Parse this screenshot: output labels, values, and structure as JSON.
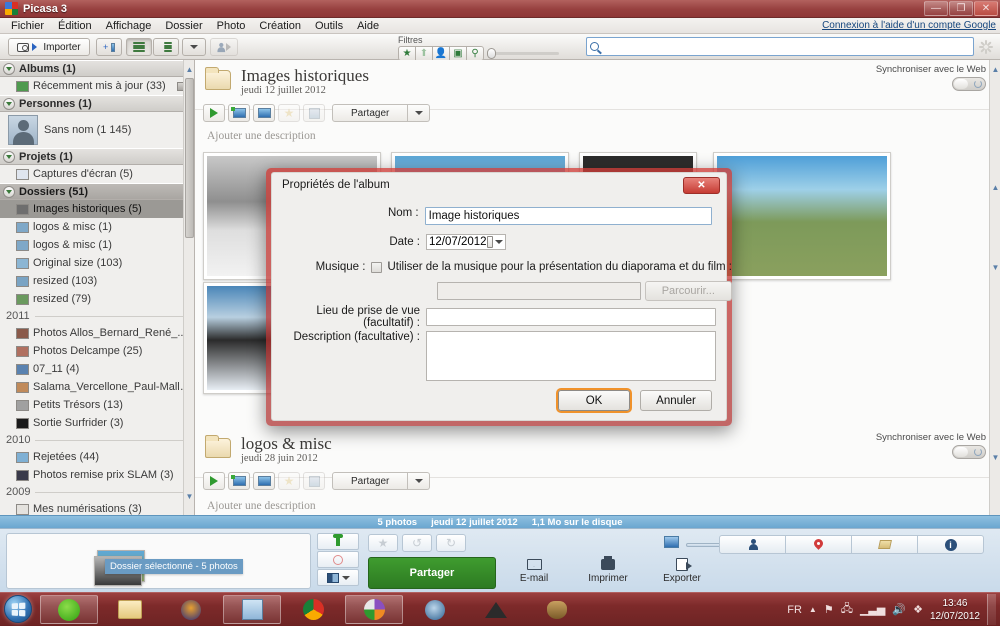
{
  "window": {
    "title": "Picasa 3",
    "minimize": "—",
    "maximize": "❐",
    "close": "✕"
  },
  "menubar": {
    "items": [
      "Fichier",
      "Édition",
      "Affichage",
      "Dossier",
      "Photo",
      "Création",
      "Outils",
      "Aide"
    ],
    "login_link": "Connexion à l'aide d'un compte Google"
  },
  "toolbar": {
    "import_label": "Importer",
    "filters_label": "Filtres",
    "filter_icons": [
      "star-filter",
      "upload-filter",
      "face-filter",
      "video-filter",
      "geotag-filter"
    ],
    "filter_glyphs": [
      "★",
      "⬆",
      "👤",
      "▣",
      "⚲"
    ],
    "search_placeholder": "",
    "search_value": ""
  },
  "sidebar": {
    "groups": [
      {
        "label": "Albums (1)",
        "items": [
          {
            "label": "Récemment mis à jour (33)",
            "color": "#4f9a4f"
          }
        ]
      },
      {
        "label": "Personnes (1)",
        "person": {
          "label": "Sans nom (1 145)"
        }
      },
      {
        "label": "Projets (1)",
        "items": [
          {
            "label": "Captures d'écran (5)",
            "color": "#cfd8e4"
          }
        ]
      },
      {
        "label": "Dossiers (51)",
        "selected": "Images historiques (5)",
        "items": [
          {
            "label": "Images historiques (5)",
            "color": "#6e6e6e",
            "selected": true
          },
          {
            "label": "logos & misc (1)",
            "color": "#7fa8c8"
          },
          {
            "label": "logos & misc (1)",
            "color": "#7fa8c8"
          },
          {
            "label": "Original size (103)",
            "color": "#8cb6d4"
          },
          {
            "label": "resized (103)",
            "color": "#7aa4c4"
          },
          {
            "label": "resized (79)",
            "color": "#6b9a5f"
          }
        ]
      }
    ],
    "years": [
      {
        "year": "2011",
        "items": [
          {
            "label": "Photos Allos_Bernard_René_...",
            "color": "#8a5a4a"
          },
          {
            "label": "Photos Delcampe (25)",
            "color": "#b07060"
          },
          {
            "label": "07_11 (4)",
            "color": "#5a82b0"
          },
          {
            "label": "Salama_Vercellone_Paul-Malle...",
            "color": "#c08a5a"
          },
          {
            "label": "Petits Trésors (13)",
            "color": "#a0a0a0"
          },
          {
            "label": "Sortie Surfrider (3)",
            "color": "#1a1a1a"
          }
        ]
      },
      {
        "year": "2010",
        "items": [
          {
            "label": "Rejetées (44)",
            "color": "#7fb0d4"
          },
          {
            "label": "Photos remise prix  SLAM (3)",
            "color": "#3a3a4a"
          }
        ]
      },
      {
        "year": "2009",
        "items": [
          {
            "label": "Mes numérisations (3)",
            "color": "#e4e2de"
          }
        ]
      }
    ]
  },
  "main": {
    "folders": [
      {
        "title": "Images historiques",
        "date": "jeudi 12 juillet 2012",
        "sync_label": "Synchroniser avec le Web",
        "share_label": "Partager",
        "add_description": "Ajouter une description"
      },
      {
        "title": "logos & misc",
        "date": "jeudi 28 juin 2012",
        "sync_label": "Synchroniser avec le Web",
        "share_label": "Partager",
        "add_description": "Ajouter une description"
      }
    ]
  },
  "statusbar": {
    "photo_count": "5 photos",
    "date": "jeudi 12 juillet 2012",
    "size": "1,1 Mo sur le disque"
  },
  "tray": {
    "badge": "Dossier sélectionné - 5 photos",
    "share_button": "Partager",
    "actions": [
      {
        "label": "E-mail",
        "icon": "envelope-icon"
      },
      {
        "label": "Imprimer",
        "icon": "printer-icon"
      },
      {
        "label": "Exporter",
        "icon": "export-icon"
      }
    ],
    "view_tabs": [
      "people-view",
      "places-view",
      "tags-view",
      "info-view"
    ]
  },
  "dialog": {
    "title": "Propriétés de l'album",
    "close_label": "✕",
    "fields": {
      "name_label": "Nom :",
      "name_value": "Image historiques",
      "date_label": "Date :",
      "date_value": "12/07/2012",
      "music_label": "Musique :",
      "music_checkbox_label": "Utiliser de la musique pour la présentation du diaporama et du film :",
      "music_path_value": "",
      "browse_label": "Parcourir...",
      "place_label": "Lieu de prise de vue (facultatif) :",
      "place_value": "",
      "description_label": "Description (facultative) :",
      "description_value": ""
    },
    "ok_label": "OK",
    "cancel_label": "Annuler"
  },
  "taskbar": {
    "start": "start-orb",
    "apps": [
      "spotify",
      "explorer",
      "audio-app",
      "picasa-photo-viewer",
      "chrome",
      "picasa",
      "thunderbird",
      "inkscape",
      "gimp"
    ],
    "language": "FR",
    "clock_time": "13:46",
    "clock_date": "12/07/2012"
  }
}
